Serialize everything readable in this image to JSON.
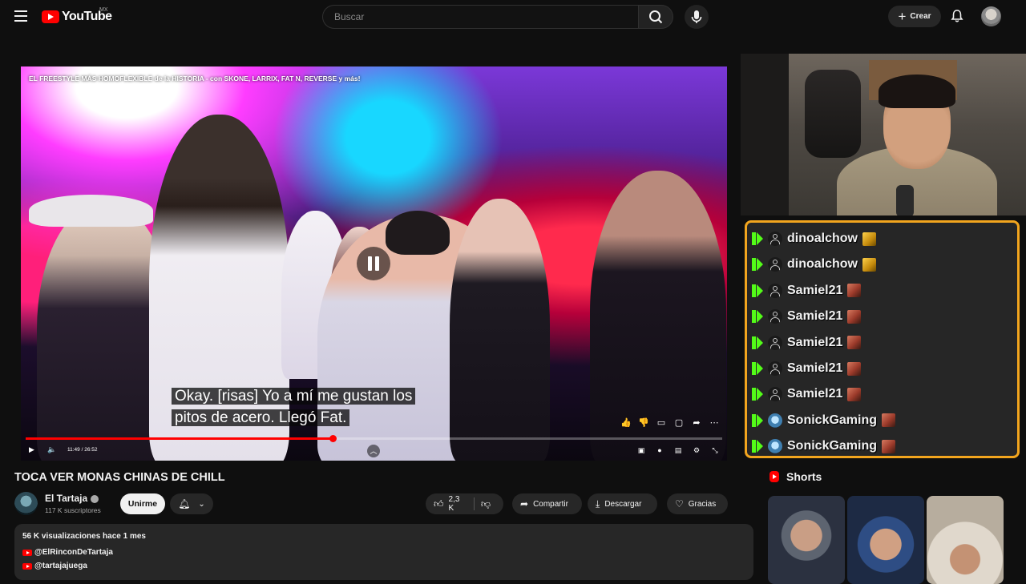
{
  "header": {
    "logo_text": "YouTube",
    "country_code": "MX",
    "search_placeholder": "Buscar",
    "create_label": "Crear"
  },
  "player": {
    "overlay_title": "EL FREESTYLE MÁS HOMOFLEXIBLE de la HISTORIA - con SKONE, LARRIX, FAT N, REVERSE y más!",
    "caption_line1": "Okay. [risas] Yo a mí me gustan los",
    "caption_line2": "pitos de acero. Llegó Fat.",
    "time": "11:49 / 26:52",
    "progress": 0.441,
    "state": "playing"
  },
  "chat": {
    "messages": [
      {
        "user": "dinoalchow",
        "avatar": "generic",
        "emote": "gold"
      },
      {
        "user": "dinoalchow",
        "avatar": "generic",
        "emote": "gold"
      },
      {
        "user": "Samiel21",
        "avatar": "generic",
        "emote": "red"
      },
      {
        "user": "Samiel21",
        "avatar": "generic",
        "emote": "red"
      },
      {
        "user": "Samiel21",
        "avatar": "generic",
        "emote": "red"
      },
      {
        "user": "Samiel21",
        "avatar": "generic",
        "emote": "red"
      },
      {
        "user": "Samiel21",
        "avatar": "generic",
        "emote": "red"
      },
      {
        "user": "SonickGaming",
        "avatar": "sonic",
        "emote": "red"
      },
      {
        "user": "SonickGaming",
        "avatar": "sonic",
        "emote": "red"
      }
    ],
    "border_color": "#f2a51e",
    "badge_color": "#53fc18"
  },
  "video": {
    "title": "TOCA VER MONAS CHINAS DE CHILL",
    "channel_name": "El Tartaja",
    "subscribers": "117 K suscriptores",
    "join_label": "Unirme",
    "likes": "2,3 K",
    "share_label": "Compartir",
    "download_label": "Descargar",
    "thanks_label": "Gracias"
  },
  "description": {
    "meta": "56 K visualizaciones  hace 1 mes",
    "links": [
      "@ElRinconDeTartaja",
      "@tartajajuega"
    ]
  },
  "shorts": {
    "title": "Shorts"
  },
  "colors": {
    "accent": "#ff0000",
    "background": "#0f0f0f"
  }
}
